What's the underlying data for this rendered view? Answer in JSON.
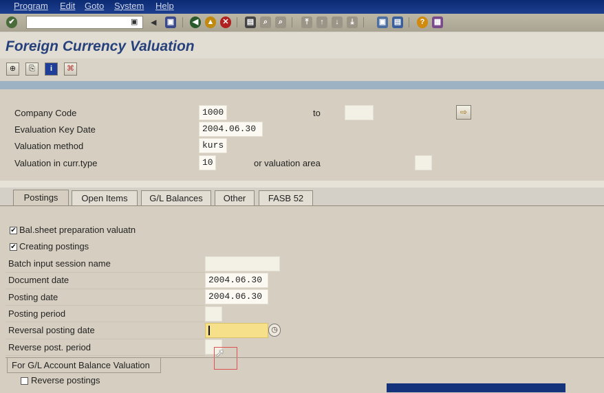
{
  "menubar": {
    "items": [
      "Program",
      "Edit",
      "Goto",
      "System",
      "Help"
    ]
  },
  "toolbar": {
    "command_field_value": "",
    "icons": [
      "enter-icon",
      "save-icon",
      "back-icon",
      "exit-icon",
      "cancel-icon",
      "print-icon",
      "find-icon",
      "find-next-icon",
      "first-page-icon",
      "previous-page-icon",
      "next-page-icon",
      "last-page-icon",
      "create-session-icon",
      "shortcut-icon",
      "help-icon",
      "layout-icon"
    ]
  },
  "title": "Foreign Currency Valuation",
  "app_toolbar": {
    "icons": [
      "execute-icon",
      "get-variant-icon",
      "info-icon",
      "program-docs-icon"
    ]
  },
  "selection": {
    "company_code_label": "Company Code",
    "company_code_value": "1000",
    "to_label": "to",
    "company_code_to_value": "",
    "eval_key_date_label": "Evaluation Key Date",
    "eval_key_date_value": "2004.06.30",
    "valuation_method_label": "Valuation method",
    "valuation_method_value": "kurs",
    "curr_type_label": "Valuation in curr.type",
    "curr_type_value": "10",
    "valuation_area_label": "or valuation area",
    "valuation_area_value": ""
  },
  "tabs": [
    {
      "label": "Postings",
      "active": true
    },
    {
      "label": "Open Items",
      "active": false
    },
    {
      "label": "G/L Balances",
      "active": false
    },
    {
      "label": "Other",
      "active": false
    },
    {
      "label": "FASB 52",
      "active": false
    }
  ],
  "postings": {
    "bal_sheet_label": "Bal.sheet preparation valuatn",
    "bal_sheet_checked": true,
    "creating_postings_label": "Creating postings",
    "creating_postings_checked": true,
    "batch_session_label": "Batch input session name",
    "batch_session_value": "",
    "document_date_label": "Document date",
    "document_date_value": "2004.06.30",
    "posting_date_label": "Posting date",
    "posting_date_value": "2004.06.30",
    "posting_period_label": "Posting period",
    "posting_period_value": "",
    "reversal_date_label": "Reversal posting date",
    "reversal_date_value": "",
    "reverse_period_label": "Reverse post. period",
    "reverse_period_value": "",
    "group_title": "For G/L Account Balance Valuation",
    "reverse_postings_label": "Reverse postings",
    "reverse_postings_checked": false
  }
}
